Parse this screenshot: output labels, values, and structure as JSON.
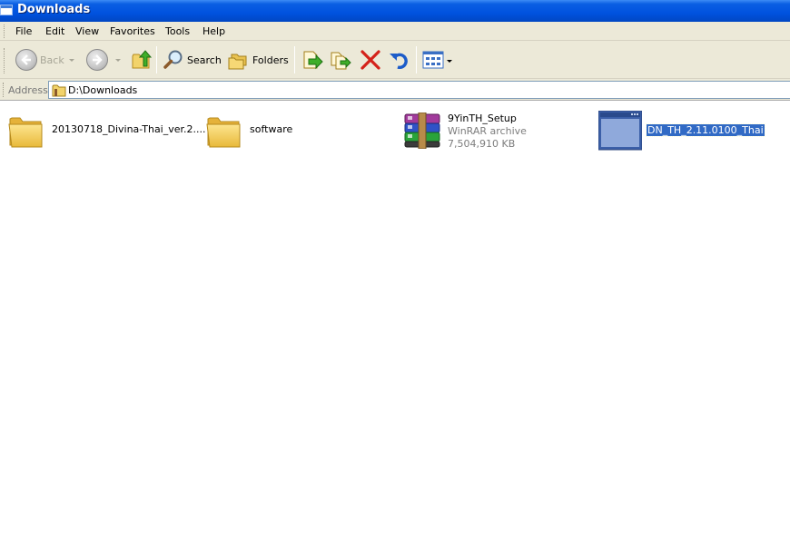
{
  "window": {
    "title": "Downloads"
  },
  "menu": [
    "File",
    "Edit",
    "View",
    "Favorites",
    "Tools",
    "Help"
  ],
  "toolbar": {
    "back_label": "Back",
    "search_label": "Search",
    "folders_label": "Folders"
  },
  "address": {
    "label": "Address",
    "value": "D:\\Downloads"
  },
  "files": [
    {
      "name": "20130718_Divina-Thai_ver.2....",
      "type": "folder"
    },
    {
      "name": "software",
      "type": "folder"
    },
    {
      "name": "9YinTH_Setup",
      "type": "winrar-archive",
      "kind": "WinRAR archive",
      "size": "7,504,910 KB"
    },
    {
      "name": "DN_TH_2.11.0100_Thai",
      "type": "application",
      "selected": true
    }
  ],
  "colors": {
    "titlebar": "#0052df",
    "chrome": "#ece9d8",
    "selection": "#316ac5"
  }
}
